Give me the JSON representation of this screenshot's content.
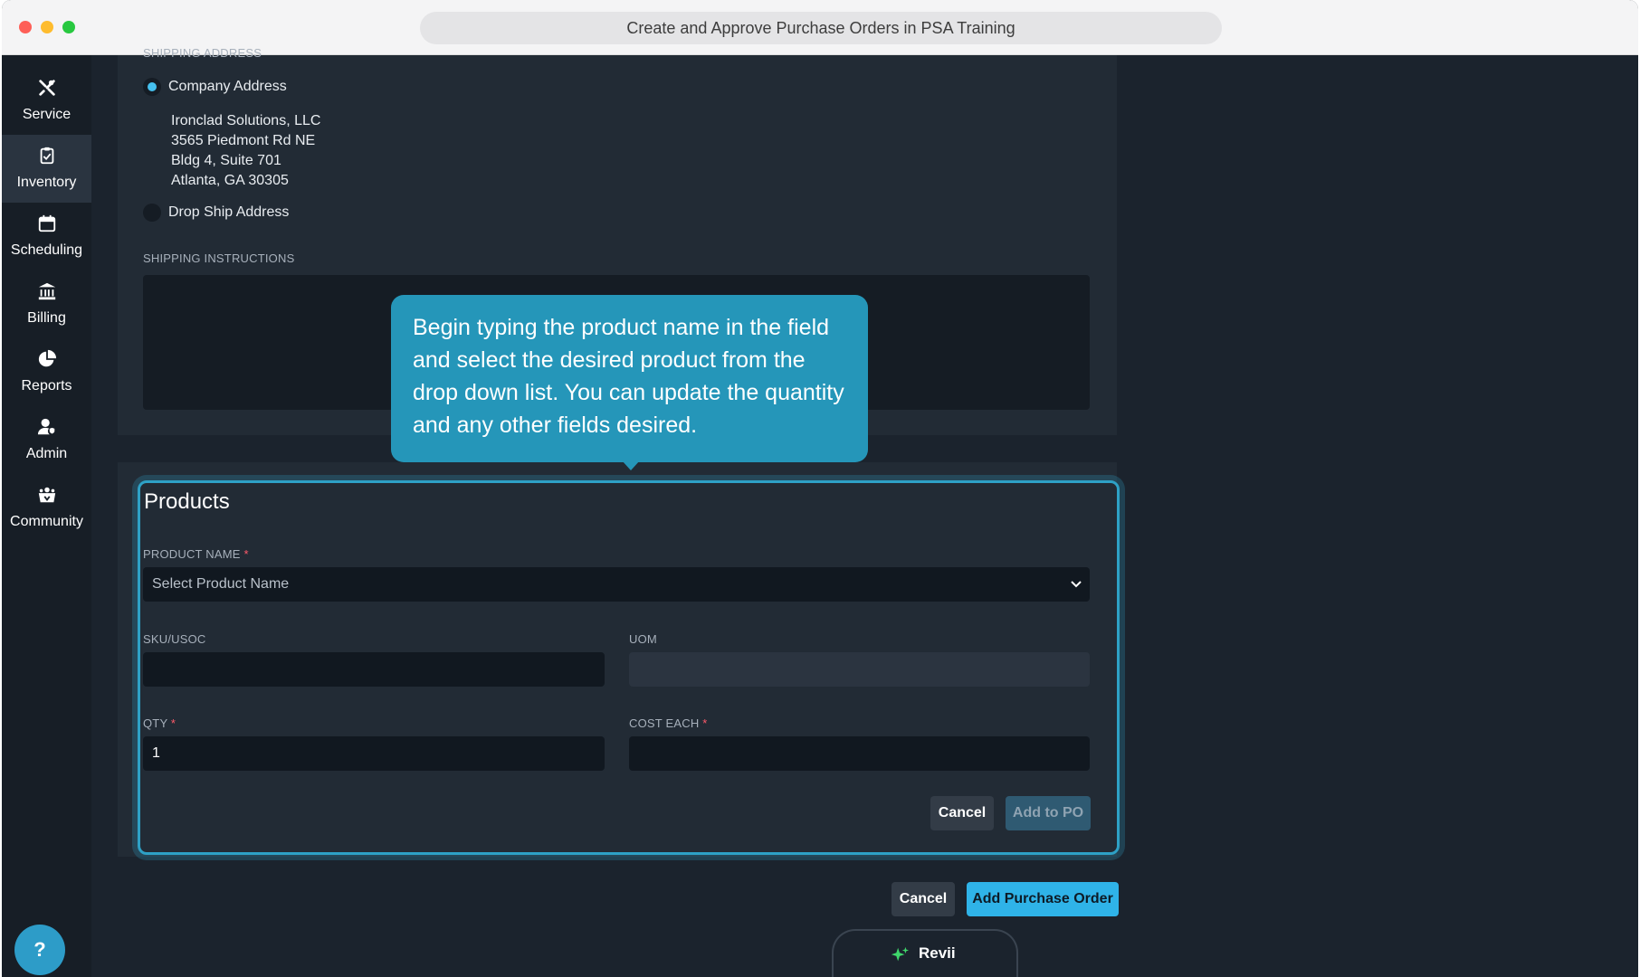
{
  "window": {
    "title": "Create and Approve Purchase Orders in PSA Training"
  },
  "sidebar": {
    "items": [
      {
        "label": "Service",
        "icon": "tools-icon"
      },
      {
        "label": "Inventory",
        "icon": "clipboard-check-icon",
        "active": true
      },
      {
        "label": "Scheduling",
        "icon": "calendar-icon"
      },
      {
        "label": "Billing",
        "icon": "bank-icon"
      },
      {
        "label": "Reports",
        "icon": "pie-chart-icon"
      },
      {
        "label": "Admin",
        "icon": "user-shield-icon"
      },
      {
        "label": "Community",
        "icon": "community-icon"
      }
    ],
    "help_label": "?"
  },
  "shipping": {
    "address_label": "SHIPPING ADDRESS",
    "company_option": "Company Address",
    "company_address_lines": [
      "Ironclad Solutions, LLC",
      "3565 Piedmont Rd NE",
      "Bldg 4, Suite 701",
      "Atlanta, GA 30305"
    ],
    "drop_ship_option": "Drop Ship Address",
    "instructions_label": "SHIPPING INSTRUCTIONS",
    "instructions_value": ""
  },
  "products": {
    "title": "Products",
    "product_name_label": "PRODUCT NAME",
    "product_name_placeholder": "Select Product Name",
    "sku_label": "SKU/USOC",
    "sku_value": "",
    "uom_label": "UOM",
    "uom_value": "",
    "qty_label": "QTY",
    "qty_value": "1",
    "cost_label": "COST EACH",
    "cost_value": "",
    "required_mark": "*",
    "cancel_label": "Cancel",
    "add_label": "Add to PO"
  },
  "footer": {
    "cancel_label": "Cancel",
    "add_po_label": "Add Purchase Order"
  },
  "revii": {
    "label": "Revii"
  },
  "tooltip": {
    "text": "Begin typing the product name in the field and select the desired product from the drop down list. You can update the quantity and any other fields desired."
  },
  "colors": {
    "accent": "#2fb3e8",
    "tooltip_bg": "#2596b9",
    "highlight_border": "#2ea1c6",
    "background": "#1b232d",
    "sidebar": "#171e26"
  }
}
